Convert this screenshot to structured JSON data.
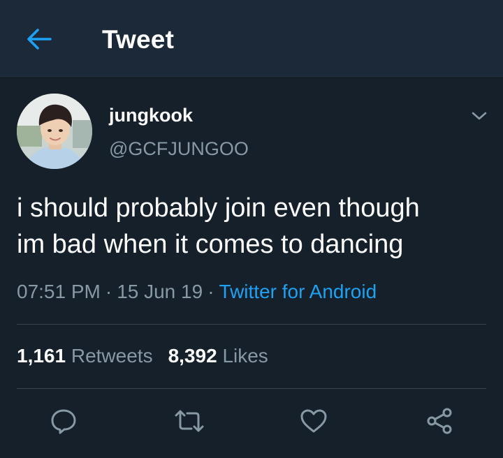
{
  "header": {
    "title": "Tweet",
    "back_icon": "arrow-left-icon"
  },
  "tweet": {
    "author": {
      "display_name": "jungkook",
      "handle": "@GCFJUNGOO",
      "avatar": "profile-photo"
    },
    "text_lines": [
      "i should probably join even though",
      "im bad when it comes to dancing"
    ],
    "time": "07:51 PM",
    "separator": "·",
    "date": "15 Jun 19",
    "source": "Twitter for Android",
    "stats": {
      "retweets_count": "1,161",
      "retweets_label": "Retweets",
      "likes_count": "8,392",
      "likes_label": "Likes"
    },
    "actions": [
      "reply-icon",
      "retweet-icon",
      "like-icon",
      "share-icon"
    ]
  },
  "colors": {
    "background": "#15202b",
    "header_background": "#1c2938",
    "accent": "#1da1f2",
    "secondary_text": "#8899a6",
    "divider": "#38444d"
  }
}
